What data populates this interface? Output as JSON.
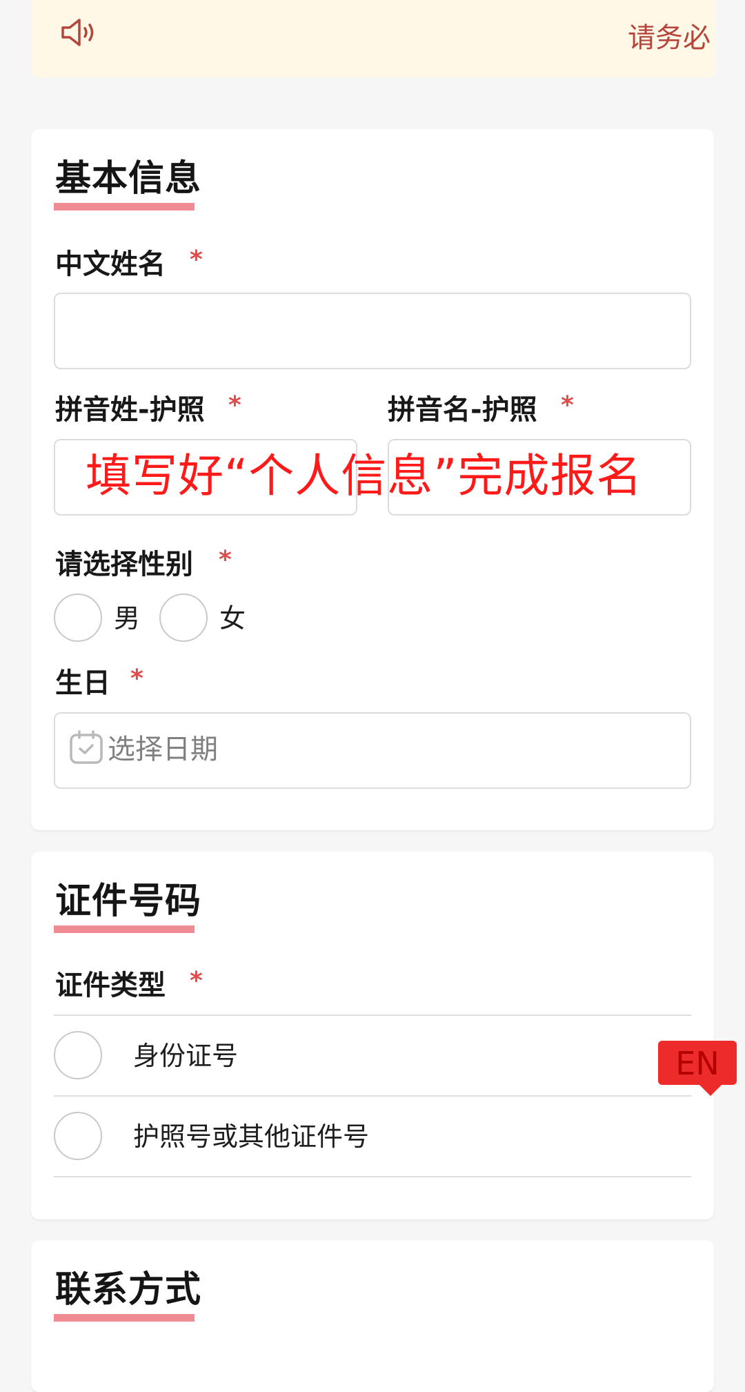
{
  "notice": {
    "text": "请务必"
  },
  "basic_info": {
    "title": "基本信息",
    "chinese_name": {
      "label": "中文姓名",
      "required_mark": "*",
      "value": ""
    },
    "surname_pinyin": {
      "label": "拼音姓-护照",
      "required_mark": "*",
      "value": ""
    },
    "given_name_pinyin": {
      "label": "拼音名-护照",
      "required_mark": "*",
      "value": ""
    },
    "gender": {
      "label": "请选择性别",
      "required_mark": "*",
      "options": [
        "男",
        "女"
      ]
    },
    "birthday": {
      "label": "生日",
      "required_mark": "*",
      "placeholder": "选择日期"
    }
  },
  "overlay_caption": "填写好“个人信息”完成报名",
  "id_info": {
    "title": "证件号码",
    "id_type": {
      "label": "证件类型",
      "required_mark": "*",
      "options": [
        "身份证号",
        "护照号或其他证件号"
      ]
    }
  },
  "contact": {
    "title": "联系方式"
  },
  "language_button": {
    "label": "EN"
  },
  "colors": {
    "accent_underline": "#ef8c93",
    "required": "#e14b4b",
    "notice_bg": "#fff8e6",
    "notice_text": "#b5453b",
    "overlay_text": "#ff1a1a",
    "lang_button": "#ee2b2b"
  }
}
